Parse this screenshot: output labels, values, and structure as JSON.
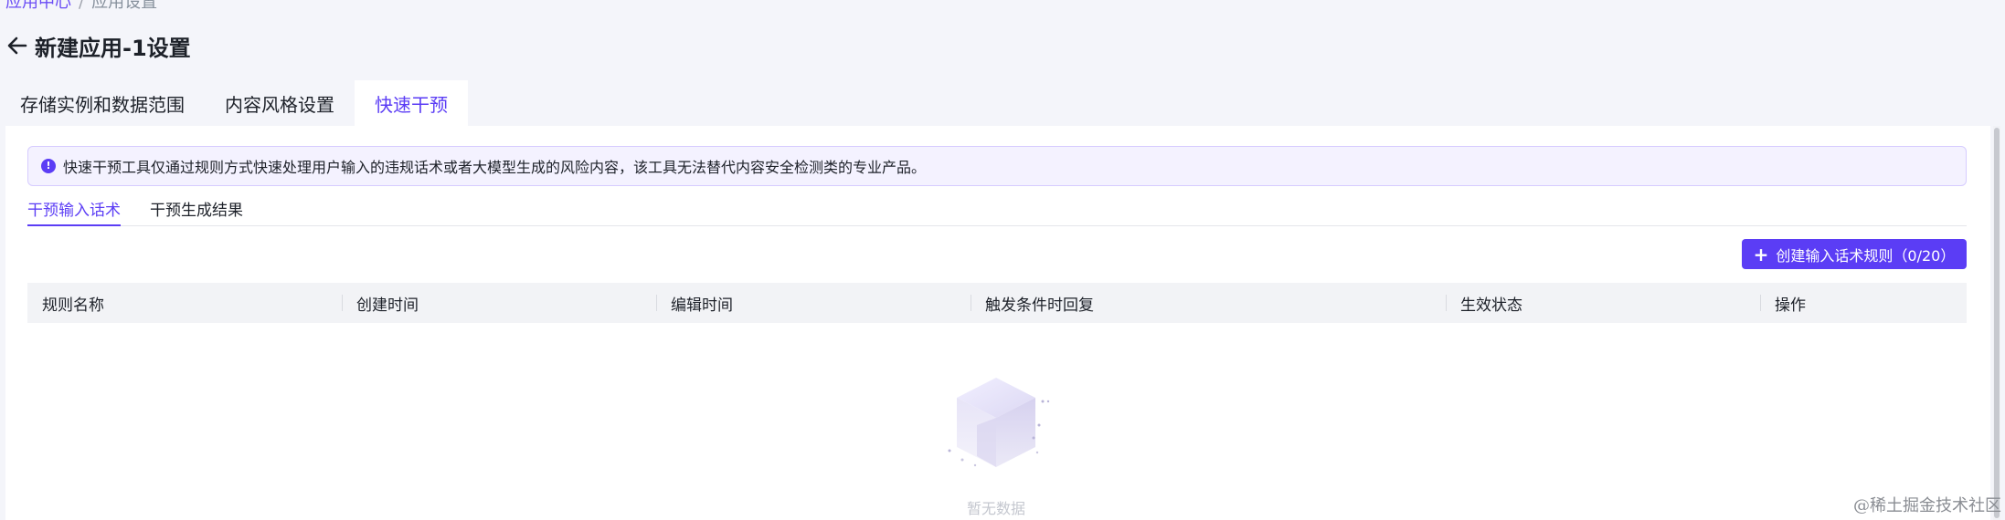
{
  "breadcrumb": {
    "parent": "应用中心",
    "separator": "/",
    "current": "应用设置"
  },
  "header": {
    "back_icon": "arrow-left-icon",
    "title": "新建应用-1设置"
  },
  "tabs": [
    {
      "label": "存储实例和数据范围",
      "active": false
    },
    {
      "label": "内容风格设置",
      "active": false
    },
    {
      "label": "快速干预",
      "active": true
    }
  ],
  "alert": {
    "icon": "info-icon",
    "text": "快速干预工具仅通过规则方式快速处理用户输入的违规话术或者大模型生成的风险内容，该工具无法替代内容安全检测类的专业产品。"
  },
  "subtabs": [
    {
      "label": "干预输入话术",
      "active": true
    },
    {
      "label": "干预生成结果",
      "active": false
    }
  ],
  "create_button": {
    "label": "创建输入话术规则（0/20）"
  },
  "table": {
    "columns": [
      "规则名称",
      "创建时间",
      "编辑时间",
      "触发条件时回复",
      "生效状态",
      "操作"
    ],
    "rows": []
  },
  "empty_state": {
    "icon": "empty-box-icon",
    "text": "暂无数据"
  },
  "watermark": "@稀土掘金技术社区",
  "colors": {
    "accent": "#5b3df5",
    "page_bg": "#f4f5fa",
    "alert_bg": "#f4f2ff"
  }
}
